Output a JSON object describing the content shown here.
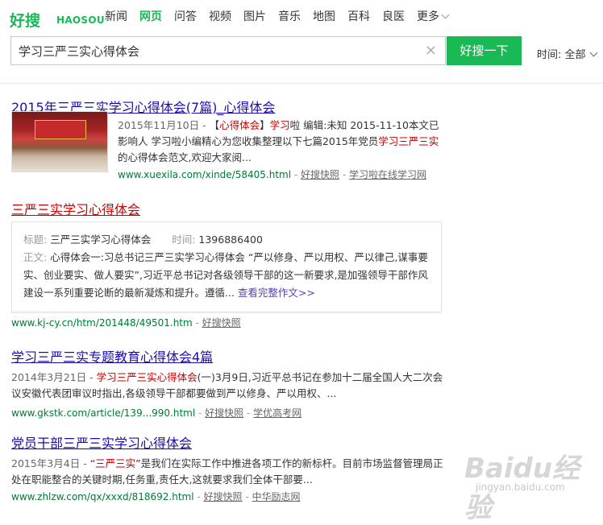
{
  "logo": {
    "cn": "好搜",
    "en": "HAOSOU"
  },
  "nav": [
    "新闻",
    "网页",
    "问答",
    "视频",
    "图片",
    "音乐",
    "地图",
    "百科",
    "良医",
    "更多"
  ],
  "nav_active_index": 1,
  "search": {
    "query": "学习三严三实心得体会",
    "button": "好搜一下",
    "clear": "×"
  },
  "time_filter": {
    "label": "时间:",
    "value": "全部"
  },
  "results": [
    {
      "title": "2015年三严三实学习心得体会(7篇)_心得体会",
      "date_prefix": "2015年11月10日 - ",
      "snippet_a": "【",
      "snippet_hl1": "心得体会",
      "snippet_b": "】",
      "snippet_hl2": "学习",
      "snippet_c": "啦 编辑:未知 2015-11-10本文已影响人 学习啦小编精心为您收集整理以下七篇2015年党员",
      "snippet_hl3": "学习三严三实",
      "snippet_d": "的心得体会范文,欢迎大家阅...",
      "url": "www.xuexila.com/xinde/58405.html",
      "sep": " - ",
      "cache": "好搜快照",
      "source": "学习啦在线学习网"
    },
    {
      "title": "三严三实学习心得体会",
      "card_title_label": "标题:",
      "card_title": "三严三实学习心得体会",
      "card_time_label": "时间:",
      "card_time": "1396886400",
      "card_body_label": "正文:",
      "card_body": "心得体会一:习总书记三严三实学习心得体会 “严以修身、严以用权、严以律己,谋事要实、创业要实、做人要实”,习近平总书记对各级领导干部的这一新要求,是加强领导干部作风建设一系列重要论断的最新凝炼和提升。遵循...",
      "card_more": "查看完整作文>>",
      "url": "www.kj-cy.cn/htm/201448/49501.htm",
      "sep": " - ",
      "cache": "好搜快照"
    },
    {
      "title": "学习三严三实专题教育心得体会4篇",
      "date_prefix": "2014年3月21日 - ",
      "snippet_hl1": "学习三严三实心得体会",
      "snippet_a": "(一)3月9日,习近平总书记在参加十二届全国人大二次会议安徽代表团审议时指出,各级领导干部都要做到严以修身、严以用权、...",
      "url": "www.gkstk.com/article/139...990.html",
      "sep": " - ",
      "cache": "好搜快照",
      "source": "学优高考网"
    },
    {
      "title": "党员干部三严三实学习心得体会",
      "date_prefix": "2015年3月4日 - ",
      "snippet_hl1": "“三严三实”",
      "snippet_a": "是我们在实际工作中推进各项工作的新标杆。目前市场监督管理局正处在职能整合的关键时期,任务重,责任大,这就要求我们全体干部要...",
      "url": "www.zhlzw.com/qx/xxxd/818692.html",
      "sep": " - ",
      "cache": "好搜快照",
      "source": "中华励志网"
    }
  ],
  "watermark": {
    "big": "Baidu经验",
    "small": "jingyan.baidu.com"
  },
  "colors": {
    "brand_green": "#19b955",
    "link_blue": "#1a0dab",
    "highlight_red": "#cc0000",
    "url_green": "#007a35"
  }
}
